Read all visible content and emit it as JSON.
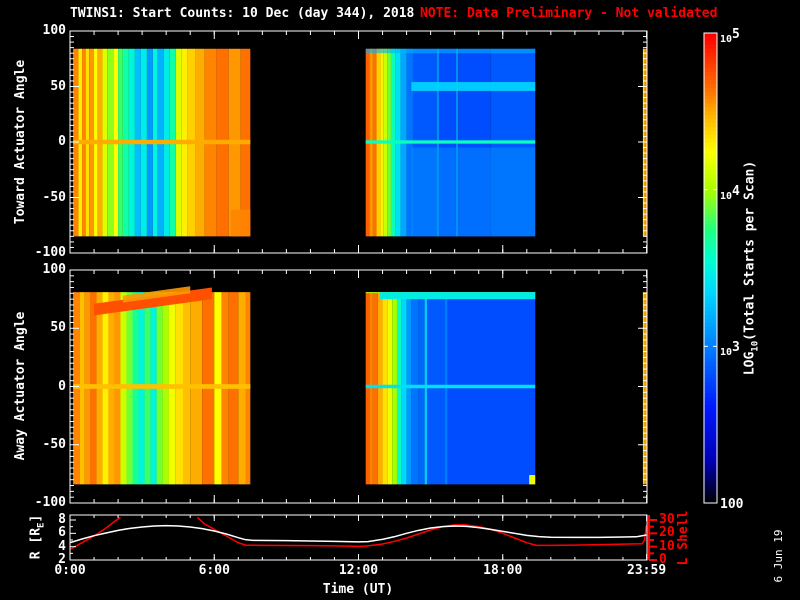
{
  "title": "TWINS1: Start Counts: 10 Dec (day 344), 2018",
  "note": "NOTE: Data Preliminary - Not validated",
  "datestamp": "6 Jun 19",
  "colors": {
    "background": "#000000",
    "axis_white": "#ffffff",
    "note_red": "#ff0000",
    "l_shell_red": "#ff0000",
    "r_line_white": "#ffffff"
  },
  "x_axis": {
    "label": "Time (UT)",
    "range_hours": [
      0,
      24
    ],
    "major_ticks": [
      {
        "t": 0,
        "label": "0:00"
      },
      {
        "t": 6,
        "label": "6:00"
      },
      {
        "t": 12,
        "label": "12:00"
      },
      {
        "t": 18,
        "label": "18:00"
      },
      {
        "t": 23.983,
        "label": "23:59"
      }
    ],
    "minor_step_hours": 1
  },
  "colorbar": {
    "label": {
      "pre": "LOG",
      "sub": "10",
      "post": "(Total Starts per Scan)"
    },
    "range_log10": [
      2,
      5
    ],
    "ticks": [
      {
        "logv": 5,
        "base": "10",
        "sup": "5"
      },
      {
        "logv": 4,
        "base": "10",
        "sup": "4"
      },
      {
        "logv": 3,
        "base": "10",
        "sup": "3"
      },
      {
        "logv": 2,
        "base": "100",
        "sup": ""
      }
    ],
    "colormap_stops": [
      [
        2.0,
        "#000008"
      ],
      [
        2.25,
        "#0000b0"
      ],
      [
        2.6,
        "#0018ff"
      ],
      [
        3.0,
        "#0080ff"
      ],
      [
        3.35,
        "#00d8ff"
      ],
      [
        3.55,
        "#00ffd0"
      ],
      [
        3.75,
        "#20ff80"
      ],
      [
        4.0,
        "#a8ff00"
      ],
      [
        4.25,
        "#ffff00"
      ],
      [
        4.45,
        "#ffc000"
      ],
      [
        4.65,
        "#ff7000"
      ],
      [
        5.0,
        "#ff0000"
      ]
    ]
  },
  "chart_data": {
    "type": "heatmap",
    "x_unit": "hours UT",
    "value_unit": "log10(total starts per scan)",
    "panels": [
      {
        "id": "toward",
        "ylabel": "Toward Actuator Angle",
        "ylim": [
          -100,
          100
        ],
        "y_ticks": [
          {
            "v": 100,
            "label": "100"
          },
          {
            "v": 50,
            "label": "50"
          },
          {
            "v": 0,
            "label": "0"
          },
          {
            "v": -50,
            "label": "-50"
          },
          {
            "v": -100,
            "label": "-100"
          }
        ],
        "data_angle_extent": [
          -85,
          84
        ],
        "stripes": [
          [
            0.13,
            0.35,
            4.6
          ],
          [
            0.35,
            0.5,
            4.3
          ],
          [
            0.5,
            0.65,
            4.6
          ],
          [
            0.65,
            0.8,
            4.35
          ],
          [
            0.8,
            1.0,
            4.55
          ],
          [
            1.0,
            1.15,
            4.25
          ],
          [
            1.15,
            1.35,
            4.5
          ],
          [
            1.35,
            1.55,
            4.15
          ],
          [
            1.55,
            1.8,
            3.95
          ],
          [
            1.8,
            2.0,
            4.25
          ],
          [
            2.0,
            2.2,
            3.8
          ],
          [
            2.2,
            2.45,
            3.65
          ],
          [
            2.45,
            2.7,
            3.5
          ],
          [
            2.7,
            2.95,
            3.25
          ],
          [
            2.95,
            3.2,
            3.45
          ],
          [
            3.2,
            3.45,
            3.1
          ],
          [
            3.45,
            3.65,
            3.5
          ],
          [
            3.65,
            3.9,
            3.2
          ],
          [
            3.9,
            4.15,
            3.45
          ],
          [
            4.15,
            4.4,
            3.65
          ],
          [
            4.4,
            4.65,
            4.15
          ],
          [
            4.65,
            4.9,
            4.3
          ],
          [
            4.9,
            5.2,
            4.4
          ],
          [
            5.2,
            5.6,
            4.5
          ],
          [
            5.6,
            6.1,
            4.6
          ],
          [
            6.1,
            6.6,
            4.65
          ],
          [
            6.6,
            7.1,
            4.55
          ],
          [
            7.1,
            7.5,
            4.65
          ],
          [
            12.3,
            12.45,
            4.7
          ],
          [
            12.45,
            12.6,
            4.55
          ],
          [
            12.6,
            12.75,
            4.65
          ],
          [
            12.75,
            12.9,
            4.4
          ],
          [
            12.9,
            13.05,
            4.3
          ],
          [
            13.05,
            13.2,
            4.1
          ],
          [
            13.2,
            13.35,
            3.9
          ],
          [
            13.35,
            13.55,
            3.6
          ],
          [
            13.55,
            13.75,
            3.4
          ],
          [
            13.75,
            14.0,
            3.15
          ],
          [
            14.0,
            14.3,
            2.95
          ],
          [
            14.3,
            15.25,
            2.85
          ],
          [
            15.25,
            15.35,
            3.05
          ],
          [
            15.35,
            16.05,
            2.8
          ],
          [
            16.05,
            16.15,
            3.05
          ],
          [
            16.15,
            17.5,
            2.8
          ],
          [
            17.5,
            19.35,
            2.85
          ],
          [
            23.83,
            23.9,
            4.35
          ],
          [
            23.9,
            23.98,
            4.6
          ]
        ],
        "features": [
          {
            "shape": "hline",
            "t": [
              0.13,
              7.5
            ],
            "angle": 0,
            "half": 2,
            "logv": 4.5
          },
          {
            "shape": "hline",
            "t": [
              12.3,
              19.35
            ],
            "angle": 0,
            "half": 1.5,
            "logv": 3.6
          },
          {
            "shape": "hband",
            "t": [
              14.2,
              19.35
            ],
            "angle": 50,
            "half": 4,
            "logv": 3.35,
            "opacity": 0.9
          },
          {
            "shape": "hband",
            "t": [
              14.2,
              19.35
            ],
            "angle": -45,
            "half": 40,
            "logv": 3.1,
            "opacity": 0.45
          },
          {
            "shape": "hband",
            "t": [
              12.3,
              19.35
            ],
            "angle": 83,
            "half": 3,
            "logv": 3.2,
            "opacity": 0.6
          },
          {
            "shape": "hband",
            "t": [
              6.7,
              7.5
            ],
            "angle": -73,
            "half": 12,
            "logv": 4.6,
            "opacity": 0.9
          }
        ]
      },
      {
        "id": "away",
        "ylabel": "Away Actuator Angle",
        "ylim": [
          -100,
          100
        ],
        "y_ticks": [
          {
            "v": 100,
            "label": "100"
          },
          {
            "v": 50,
            "label": "50"
          },
          {
            "v": 0,
            "label": "0"
          },
          {
            "v": -50,
            "label": "-50"
          },
          {
            "v": -100,
            "label": "-100"
          }
        ],
        "data_angle_extent": [
          -84,
          81
        ],
        "stripes": [
          [
            0.13,
            0.4,
            4.6
          ],
          [
            0.4,
            0.6,
            4.45
          ],
          [
            0.6,
            0.85,
            4.55
          ],
          [
            0.85,
            1.1,
            4.65
          ],
          [
            1.1,
            1.35,
            4.5
          ],
          [
            1.35,
            1.6,
            4.3
          ],
          [
            1.6,
            1.85,
            4.5
          ],
          [
            1.85,
            2.1,
            4.55
          ],
          [
            2.1,
            2.35,
            4.1
          ],
          [
            2.35,
            2.6,
            3.9
          ],
          [
            2.6,
            2.85,
            3.7
          ],
          [
            2.85,
            3.1,
            3.5
          ],
          [
            3.1,
            3.35,
            3.8
          ],
          [
            3.35,
            3.6,
            3.5
          ],
          [
            3.6,
            3.85,
            3.9
          ],
          [
            3.85,
            4.1,
            4.0
          ],
          [
            4.1,
            4.4,
            4.2
          ],
          [
            4.4,
            4.7,
            4.35
          ],
          [
            4.7,
            5.0,
            4.45
          ],
          [
            5.0,
            5.5,
            4.5
          ],
          [
            5.5,
            6.0,
            4.65
          ],
          [
            6.0,
            6.3,
            4.25
          ],
          [
            6.3,
            6.6,
            4.6
          ],
          [
            6.6,
            7.0,
            4.65
          ],
          [
            7.0,
            7.3,
            4.5
          ],
          [
            7.3,
            7.5,
            4.6
          ],
          [
            12.3,
            12.45,
            4.7
          ],
          [
            12.45,
            12.6,
            4.6
          ],
          [
            12.6,
            12.8,
            4.65
          ],
          [
            12.8,
            13.0,
            4.5
          ],
          [
            13.0,
            13.2,
            4.35
          ],
          [
            13.2,
            13.4,
            4.2
          ],
          [
            13.4,
            13.6,
            4.0
          ],
          [
            13.6,
            13.8,
            3.6
          ],
          [
            13.8,
            14.0,
            3.35
          ],
          [
            14.0,
            14.2,
            3.1
          ],
          [
            14.2,
            14.5,
            2.95
          ],
          [
            14.5,
            14.75,
            2.9
          ],
          [
            14.75,
            14.85,
            3.3
          ],
          [
            14.85,
            15.6,
            2.85
          ],
          [
            15.6,
            15.7,
            3.0
          ],
          [
            15.7,
            19.35,
            2.8
          ],
          [
            23.83,
            23.9,
            4.4
          ],
          [
            23.9,
            23.98,
            4.55
          ]
        ],
        "features": [
          {
            "shape": "diag",
            "from": [
              1.0,
              66
            ],
            "to": [
              5.9,
              80
            ],
            "half": 5,
            "logv": 4.75
          },
          {
            "shape": "diag",
            "from": [
              2.2,
              75
            ],
            "to": [
              5.0,
              83
            ],
            "half": 3,
            "logv": 4.55,
            "opacity": 0.9
          },
          {
            "shape": "hline",
            "t": [
              0.13,
              7.5
            ],
            "angle": 0,
            "half": 2,
            "logv": 4.45
          },
          {
            "shape": "hline",
            "t": [
              12.3,
              19.35
            ],
            "angle": 0,
            "half": 1.5,
            "logv": 3.4
          },
          {
            "shape": "hband",
            "t": [
              12.3,
              19.35
            ],
            "angle": 86,
            "half": 2,
            "logv": 4.0
          },
          {
            "shape": "hband",
            "t": [
              12.9,
              19.35
            ],
            "angle": 78,
            "half": 3,
            "logv": 3.45
          },
          {
            "shape": "hband",
            "t": [
              19.1,
              19.35
            ],
            "angle": -80,
            "half": 4,
            "logv": 4.2
          }
        ]
      },
      {
        "id": "orbit",
        "left_axis": {
          "label": {
            "pre": "R [R",
            "sub": "E",
            "post": "]"
          },
          "ylim": [
            2,
            8
          ],
          "ticks": [
            {
              "v": 8,
              "label": "8"
            },
            {
              "v": 6,
              "label": "6"
            },
            {
              "v": 4,
              "label": "4"
            },
            {
              "v": 2,
              "label": "2"
            }
          ]
        },
        "right_axis": {
          "label": "L Shell",
          "ylim": [
            0,
            30
          ],
          "ticks": [
            {
              "v": 30,
              "label": "30"
            },
            {
              "v": 20,
              "label": "20"
            },
            {
              "v": 10,
              "label": "10"
            },
            {
              "v": 0,
              "label": "0"
            }
          ]
        },
        "r_series": [
          [
            0,
            4.6
          ],
          [
            0.5,
            5.15
          ],
          [
            1,
            5.65
          ],
          [
            1.5,
            6.05
          ],
          [
            2,
            6.45
          ],
          [
            2.5,
            6.75
          ],
          [
            3,
            6.95
          ],
          [
            3.5,
            7.1
          ],
          [
            4,
            7.15
          ],
          [
            4.5,
            7.1
          ],
          [
            5,
            6.95
          ],
          [
            5.5,
            6.7
          ],
          [
            6,
            6.35
          ],
          [
            6.5,
            5.9
          ],
          [
            7,
            5.35
          ],
          [
            7.3,
            5.05
          ],
          [
            7.6,
            4.95
          ],
          [
            9,
            4.9
          ],
          [
            10,
            4.85
          ],
          [
            11,
            4.8
          ],
          [
            12,
            4.72
          ],
          [
            12.4,
            4.75
          ],
          [
            13,
            5.1
          ],
          [
            13.5,
            5.5
          ],
          [
            14,
            6.0
          ],
          [
            14.5,
            6.45
          ],
          [
            15,
            6.8
          ],
          [
            15.5,
            7.0
          ],
          [
            16,
            7.1
          ],
          [
            16.5,
            7.05
          ],
          [
            17,
            6.85
          ],
          [
            17.5,
            6.6
          ],
          [
            18,
            6.3
          ],
          [
            18.5,
            6.0
          ],
          [
            19,
            5.7
          ],
          [
            19.5,
            5.5
          ],
          [
            20,
            5.42
          ],
          [
            21,
            5.4
          ],
          [
            22,
            5.4
          ],
          [
            23,
            5.45
          ],
          [
            23.6,
            5.5
          ],
          [
            23.97,
            5.75
          ]
        ],
        "l_series_segment1": [
          [
            0,
            8
          ],
          [
            0.5,
            13
          ],
          [
            1,
            18
          ],
          [
            1.5,
            24
          ],
          [
            1.9,
            29.5
          ],
          [
            2.1,
            32
          ]
        ],
        "l_series_segment2": [
          [
            5.3,
            32
          ],
          [
            5.6,
            27
          ],
          [
            6,
            23
          ],
          [
            6.5,
            18
          ],
          [
            7,
            13
          ],
          [
            7.3,
            11.2
          ],
          [
            8,
            11
          ],
          [
            9,
            10.9
          ],
          [
            10,
            10.8
          ],
          [
            11,
            10.6
          ],
          [
            12,
            10.2
          ],
          [
            12.3,
            10.4
          ],
          [
            13,
            12
          ],
          [
            13.5,
            14
          ],
          [
            14,
            16.5
          ],
          [
            14.5,
            19.5
          ],
          [
            15,
            22.5
          ],
          [
            15.5,
            25
          ],
          [
            16,
            26.3
          ],
          [
            16.4,
            26.4
          ],
          [
            17,
            25
          ],
          [
            17.5,
            23
          ],
          [
            18,
            20
          ],
          [
            18.5,
            16.5
          ],
          [
            19,
            13
          ],
          [
            19.4,
            11
          ],
          [
            20,
            11
          ],
          [
            21,
            11.2
          ],
          [
            22,
            11.5
          ],
          [
            23,
            11.9
          ],
          [
            23.8,
            12.2
          ],
          [
            23.9,
            15
          ],
          [
            23.97,
            26
          ]
        ]
      }
    ]
  }
}
